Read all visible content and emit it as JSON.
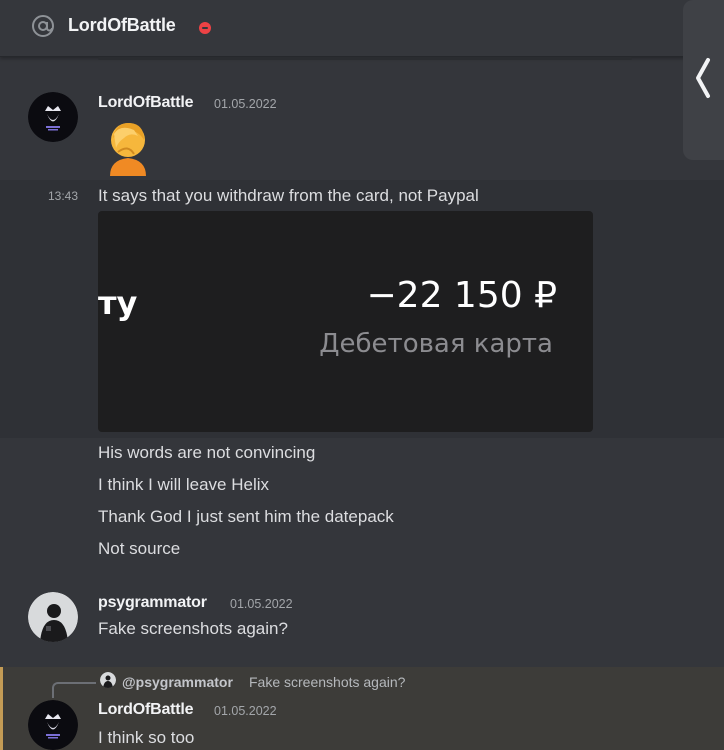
{
  "header": {
    "title": "LordOfBattle",
    "status_icon": "dnd-status-icon",
    "type_icon": "at-icon"
  },
  "side_panel": {
    "icon": "chevron-left-icon"
  },
  "messages": [
    {
      "username": "LordOfBattle",
      "date": "01.05.2022",
      "emoji": "face-palm-emoji"
    },
    {
      "time": "13:43",
      "text": "It says that you withdraw from the card, not Paypal"
    },
    {
      "attachment": {
        "partial_text": "ту",
        "amount": "−22 150 ₽",
        "description": "Дебетовая карта"
      }
    },
    {
      "text": "His words are not convincing"
    },
    {
      "text": "I think I will leave Helix"
    },
    {
      "text": "Thank God I just sent him the datepack"
    },
    {
      "text": "Not source"
    }
  ],
  "message2": {
    "username": "psygrammator",
    "date": "01.05.2022",
    "text": "Fake screenshots again?"
  },
  "message3": {
    "reply": {
      "user": "@psygrammator",
      "text": "Fake screenshots again?"
    },
    "username": "LordOfBattle",
    "date": "01.05.2022",
    "text": "I think so too"
  },
  "colors": {
    "background": "#34363b",
    "reply_accent": "#c39b55",
    "dnd": "#ed4245"
  }
}
